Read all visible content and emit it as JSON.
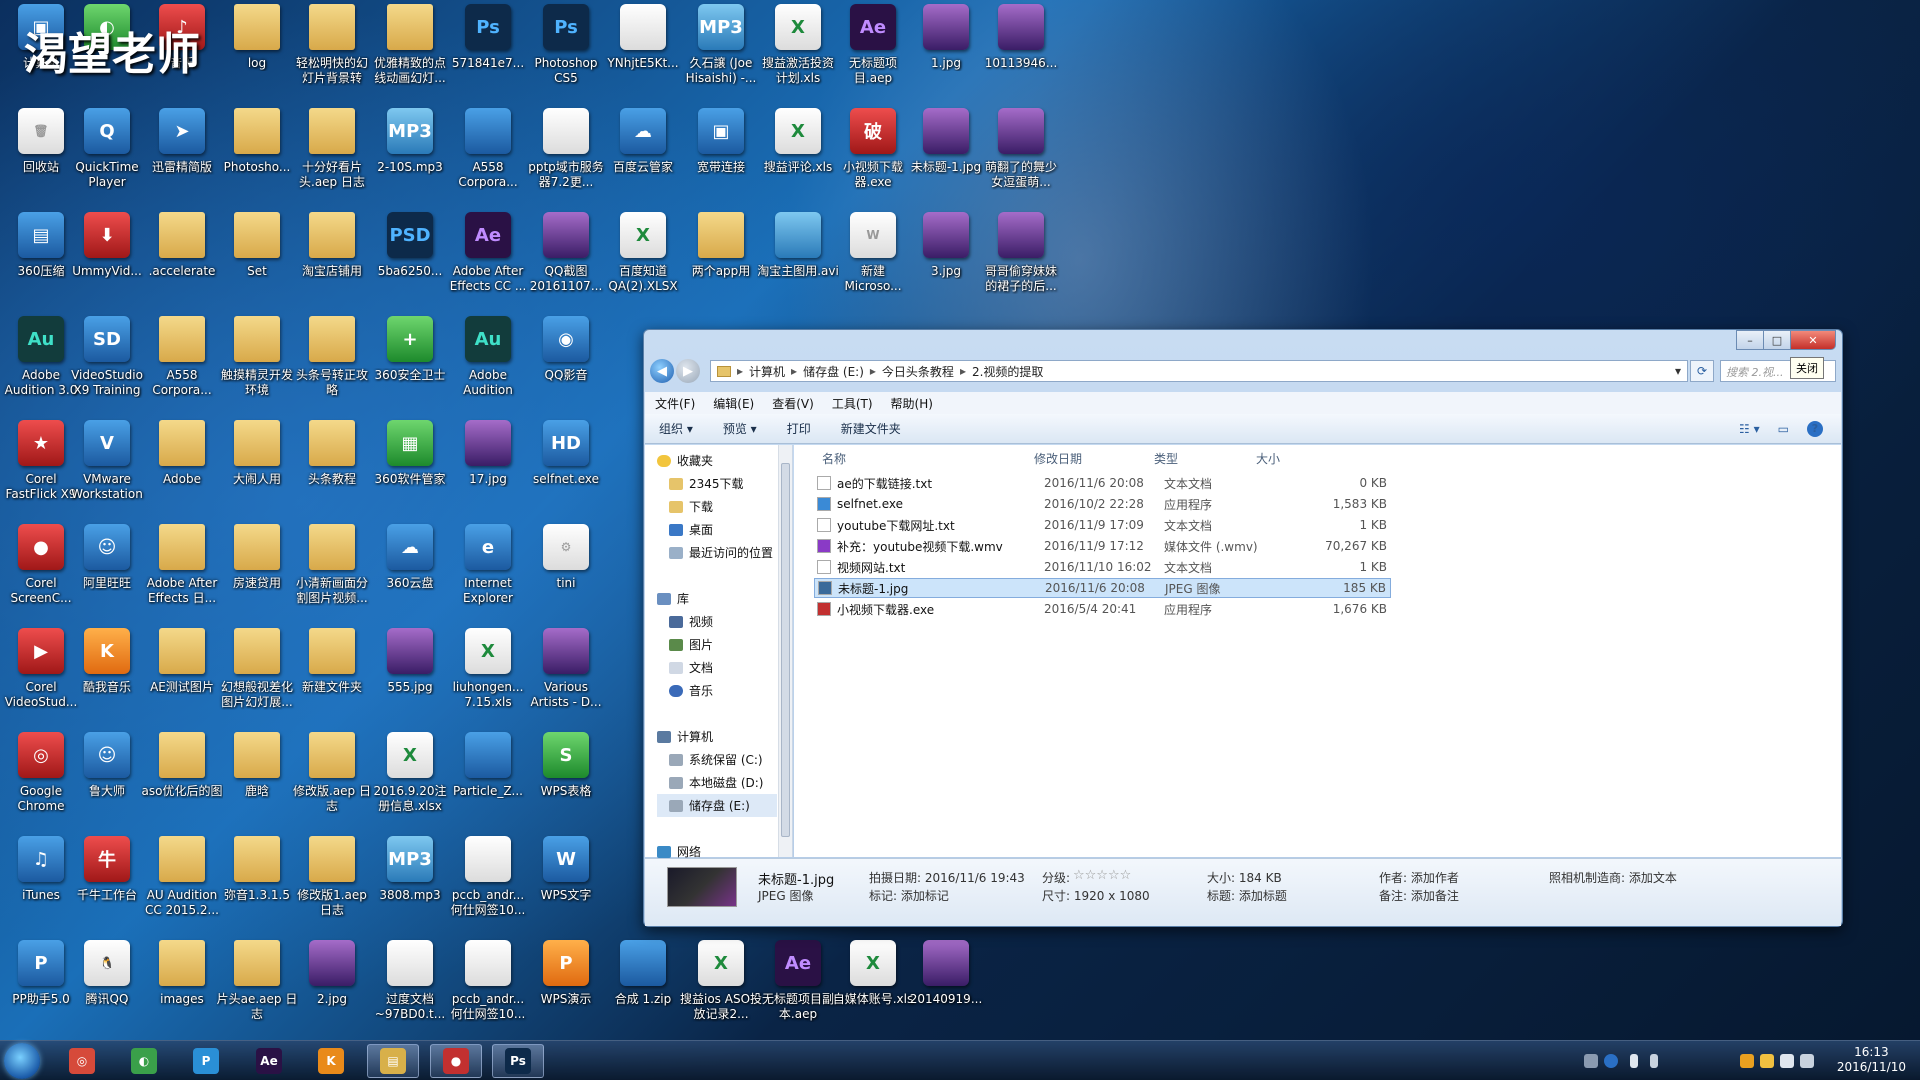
{
  "watermark": "渴望老师",
  "desktop_icons": [
    {
      "id": "r1c1",
      "label": "计算机",
      "kind": "exe",
      "glyph": "▣"
    },
    {
      "id": "r1c2",
      "label": "",
      "kind": "green",
      "glyph": "◐"
    },
    {
      "id": "r1c3",
      "label": "音乐",
      "kind": "red",
      "glyph": "♪"
    },
    {
      "id": "r1c4",
      "label": "log",
      "kind": "folder",
      "glyph": ""
    },
    {
      "id": "r1c5",
      "label": "轻松明快的幻灯片背景转场...",
      "kind": "folder",
      "glyph": ""
    },
    {
      "id": "r1c6",
      "label": "优雅精致的点线动画幻灯...",
      "kind": "folder",
      "glyph": ""
    },
    {
      "id": "r1c7",
      "label": "571841e7...",
      "kind": "ps",
      "glyph": "Ps"
    },
    {
      "id": "r1c8",
      "label": "Photoshop CS5",
      "kind": "ps",
      "glyph": "Ps"
    },
    {
      "id": "r1c9",
      "label": "YNhjtE5Kt...",
      "kind": "doc",
      "glyph": ""
    },
    {
      "id": "r1c10",
      "label": "久石譲 (Joe Hisaishi) -...",
      "kind": "media",
      "glyph": "MP3"
    },
    {
      "id": "r1c11",
      "label": "搜益激活投资计划.xls",
      "kind": "xls",
      "glyph": "X"
    },
    {
      "id": "r1c12",
      "label": "无标题项目.aep",
      "kind": "ae",
      "glyph": "Ae"
    },
    {
      "id": "r1c13",
      "label": "1.jpg",
      "kind": "img",
      "glyph": ""
    },
    {
      "id": "r1c14",
      "label": "10113946...",
      "kind": "img",
      "glyph": ""
    },
    {
      "id": "r2c1",
      "label": "回收站",
      "kind": "doc",
      "glyph": "🗑"
    },
    {
      "id": "r2c2",
      "label": "QuickTime Player",
      "kind": "exe",
      "glyph": "Q"
    },
    {
      "id": "r2c3",
      "label": "迅雷精简版",
      "kind": "exe",
      "glyph": "➤"
    },
    {
      "id": "r2c4",
      "label": "Photosho...",
      "kind": "folder",
      "glyph": ""
    },
    {
      "id": "r2c5",
      "label": "十分好看片头.aep 日志",
      "kind": "folder",
      "glyph": ""
    },
    {
      "id": "r2c6",
      "label": "2-10S.mp3",
      "kind": "media",
      "glyph": "MP3"
    },
    {
      "id": "r2c7",
      "label": "A558 Corpora...",
      "kind": "exe",
      "glyph": ""
    },
    {
      "id": "r2c8",
      "label": "pptp域市服务器7.2更...",
      "kind": "doc",
      "glyph": ""
    },
    {
      "id": "r2c9",
      "label": "百度云管家",
      "kind": "exe",
      "glyph": "☁"
    },
    {
      "id": "r2c10",
      "label": "宽带连接",
      "kind": "exe",
      "glyph": "▣"
    },
    {
      "id": "r2c11",
      "label": "搜益评论.xls",
      "kind": "xls",
      "glyph": "X"
    },
    {
      "id": "r2c12",
      "label": "小视频下载器.exe",
      "kind": "red",
      "glyph": "破"
    },
    {
      "id": "r2c13",
      "label": "未标题-1.jpg",
      "kind": "img",
      "glyph": ""
    },
    {
      "id": "r2c14",
      "label": "萌翻了的舞少女逗蛋萌...",
      "kind": "img",
      "glyph": ""
    },
    {
      "id": "r3c1",
      "label": "360压缩",
      "kind": "exe",
      "glyph": "▤"
    },
    {
      "id": "r3c2",
      "label": "UmmyVid...",
      "kind": "red",
      "glyph": "⬇"
    },
    {
      "id": "r3c3",
      "label": ".accelerate",
      "kind": "folder",
      "glyph": ""
    },
    {
      "id": "r3c4",
      "label": "Set",
      "kind": "folder",
      "glyph": ""
    },
    {
      "id": "r3c5",
      "label": "淘宝店铺用",
      "kind": "folder",
      "glyph": ""
    },
    {
      "id": "r3c6",
      "label": "5ba6250...",
      "kind": "ps",
      "glyph": "PSD"
    },
    {
      "id": "r3c7",
      "label": "Adobe After Effects CC ...",
      "kind": "ae",
      "glyph": "Ae"
    },
    {
      "id": "r3c8",
      "label": "QQ截图20161107...",
      "kind": "img",
      "glyph": ""
    },
    {
      "id": "r3c9",
      "label": "百度知道QA(2).XLSX",
      "kind": "xls",
      "glyph": "X"
    },
    {
      "id": "r3c10",
      "label": "两个app用",
      "kind": "folder",
      "glyph": ""
    },
    {
      "id": "r3c11",
      "label": "淘宝主图用.avi",
      "kind": "media",
      "glyph": ""
    },
    {
      "id": "r3c12",
      "label": "新建 Microso...",
      "kind": "doc",
      "glyph": "W"
    },
    {
      "id": "r3c13",
      "label": "3.jpg",
      "kind": "img",
      "glyph": ""
    },
    {
      "id": "r3c14",
      "label": "哥哥偷穿妹妹的裙子的后...",
      "kind": "img",
      "glyph": ""
    },
    {
      "id": "r4c1",
      "label": "Adobe Audition 3.0",
      "kind": "au",
      "glyph": "Au"
    },
    {
      "id": "r4c2",
      "label": "VideoStudio X9 Training",
      "kind": "exe",
      "glyph": "SD"
    },
    {
      "id": "r4c3",
      "label": "A558 Corpora...",
      "kind": "folder",
      "glyph": ""
    },
    {
      "id": "r4c4",
      "label": "触摸精灵开发环境",
      "kind": "folder",
      "glyph": ""
    },
    {
      "id": "r4c5",
      "label": "头条号转正攻略",
      "kind": "folder",
      "glyph": ""
    },
    {
      "id": "r4c6",
      "label": "360安全卫士",
      "kind": "green",
      "glyph": "+"
    },
    {
      "id": "r4c7",
      "label": "Adobe Audition",
      "kind": "au",
      "glyph": "Au"
    },
    {
      "id": "r4c8",
      "label": "QQ影音",
      "kind": "exe",
      "glyph": "◉"
    },
    {
      "id": "r5c1",
      "label": "Corel FastFlick X9",
      "kind": "red",
      "glyph": "★"
    },
    {
      "id": "r5c2",
      "label": "VMware Workstation",
      "kind": "exe",
      "glyph": "V"
    },
    {
      "id": "r5c3",
      "label": "Adobe",
      "kind": "folder",
      "glyph": ""
    },
    {
      "id": "r5c4",
      "label": "大闹人用",
      "kind": "folder",
      "glyph": ""
    },
    {
      "id": "r5c5",
      "label": "头条教程",
      "kind": "folder",
      "glyph": ""
    },
    {
      "id": "r5c6",
      "label": "360软件管家",
      "kind": "green",
      "glyph": "▦"
    },
    {
      "id": "r5c7",
      "label": "17.jpg",
      "kind": "img",
      "glyph": ""
    },
    {
      "id": "r5c8",
      "label": "selfnet.exe",
      "kind": "exe",
      "glyph": "HD"
    },
    {
      "id": "r6c1",
      "label": "Corel ScreenC...",
      "kind": "red",
      "glyph": "●"
    },
    {
      "id": "r6c2",
      "label": "阿里旺旺",
      "kind": "exe",
      "glyph": "☺"
    },
    {
      "id": "r6c3",
      "label": "Adobe After Effects 日...",
      "kind": "folder",
      "glyph": ""
    },
    {
      "id": "r6c4",
      "label": "房速贷用",
      "kind": "folder",
      "glyph": ""
    },
    {
      "id": "r6c5",
      "label": "小清新画面分割图片视频...",
      "kind": "folder",
      "glyph": ""
    },
    {
      "id": "r6c6",
      "label": "360云盘",
      "kind": "exe",
      "glyph": "☁"
    },
    {
      "id": "r6c7",
      "label": "Internet Explorer",
      "kind": "exe",
      "glyph": "e"
    },
    {
      "id": "r6c8",
      "label": "tini",
      "kind": "doc",
      "glyph": "⚙"
    },
    {
      "id": "r7c1",
      "label": "Corel VideoStud...",
      "kind": "red",
      "glyph": "▶"
    },
    {
      "id": "r7c2",
      "label": "酷我音乐",
      "kind": "orange",
      "glyph": "K"
    },
    {
      "id": "r7c3",
      "label": "AE测试图片",
      "kind": "folder",
      "glyph": ""
    },
    {
      "id": "r7c4",
      "label": "幻想般视差化图片幻灯展...",
      "kind": "folder",
      "glyph": ""
    },
    {
      "id": "r7c5",
      "label": "新建文件夹",
      "kind": "folder",
      "glyph": ""
    },
    {
      "id": "r7c6",
      "label": "555.jpg",
      "kind": "img",
      "glyph": ""
    },
    {
      "id": "r7c7",
      "label": "liuhongen... 7.15.xls",
      "kind": "xls",
      "glyph": "X"
    },
    {
      "id": "r7c8",
      "label": "Various Artists - D...",
      "kind": "img",
      "glyph": ""
    },
    {
      "id": "r8c1",
      "label": "Google Chrome",
      "kind": "red",
      "glyph": "◎"
    },
    {
      "id": "r8c2",
      "label": "鲁大师",
      "kind": "exe",
      "glyph": "☺"
    },
    {
      "id": "r8c3",
      "label": "aso优化后的图",
      "kind": "folder",
      "glyph": ""
    },
    {
      "id": "r8c4",
      "label": "鹿晗",
      "kind": "folder",
      "glyph": ""
    },
    {
      "id": "r8c5",
      "label": "修改版.aep 日志",
      "kind": "folder",
      "glyph": ""
    },
    {
      "id": "r8c6",
      "label": "2016.9.20注册信息.xlsx",
      "kind": "xls",
      "glyph": "X"
    },
    {
      "id": "r8c7",
      "label": "Particle_Z...",
      "kind": "exe",
      "glyph": ""
    },
    {
      "id": "r8c8",
      "label": "WPS表格",
      "kind": "green",
      "glyph": "S"
    },
    {
      "id": "r9c1",
      "label": "iTunes",
      "kind": "exe",
      "glyph": "♫"
    },
    {
      "id": "r9c2",
      "label": "千牛工作台",
      "kind": "red",
      "glyph": "牛"
    },
    {
      "id": "r9c3",
      "label": "AU Audition CC 2015.2...",
      "kind": "folder",
      "glyph": ""
    },
    {
      "id": "r9c4",
      "label": "弥音1.3.1.5",
      "kind": "folder",
      "glyph": ""
    },
    {
      "id": "r9c5",
      "label": "修改版1.aep 日志",
      "kind": "folder",
      "glyph": ""
    },
    {
      "id": "r9c6",
      "label": "3808.mp3",
      "kind": "media",
      "glyph": "MP3"
    },
    {
      "id": "r9c7",
      "label": "pccb_andr... 何仕网签10...",
      "kind": "doc",
      "glyph": ""
    },
    {
      "id": "r9c8",
      "label": "WPS文字",
      "kind": "exe",
      "glyph": "W"
    },
    {
      "id": "r10c1",
      "label": "PP助手5.0",
      "kind": "exe",
      "glyph": "P"
    },
    {
      "id": "r10c2",
      "label": "腾讯QQ",
      "kind": "doc",
      "glyph": "🐧"
    },
    {
      "id": "r10c3",
      "label": "images",
      "kind": "folder",
      "glyph": ""
    },
    {
      "id": "r10c4",
      "label": "片头ae.aep 日志",
      "kind": "folder",
      "glyph": ""
    },
    {
      "id": "r10c5",
      "label": "2.jpg",
      "kind": "img",
      "glyph": ""
    },
    {
      "id": "r10c6",
      "label": "过度文档~97BD0.t...",
      "kind": "doc",
      "glyph": ""
    },
    {
      "id": "r10c7",
      "label": "pccb_andr... 何仕网签10...",
      "kind": "doc",
      "glyph": ""
    },
    {
      "id": "r10c8",
      "label": "WPS演示",
      "kind": "orange",
      "glyph": "P"
    },
    {
      "id": "r10c9",
      "label": "合成 1.zip",
      "kind": "exe",
      "glyph": ""
    },
    {
      "id": "r10c10",
      "label": "搜益ios ASO投放记录2...",
      "kind": "xls",
      "glyph": "X"
    },
    {
      "id": "r10c11",
      "label": "无标题项目副本.aep",
      "kind": "ae",
      "glyph": "Ae"
    },
    {
      "id": "r10c12",
      "label": "自媒体账号.xls",
      "kind": "xls",
      "glyph": "X"
    },
    {
      "id": "r10c13",
      "label": "20140919...",
      "kind": "img",
      "glyph": ""
    }
  ],
  "window": {
    "tooltip": "关闭",
    "controls": {
      "minimize": "–",
      "maximize": "□",
      "close": "✕"
    },
    "address": [
      "计算机",
      "储存盘 (E:)",
      "今日头条教程",
      "2.视频的提取"
    ],
    "search_placeholder": "搜索 2.视...",
    "menu": [
      "文件(F)",
      "编辑(E)",
      "查看(V)",
      "工具(T)",
      "帮助(H)"
    ],
    "toolbar": {
      "organize": "组织 ▾",
      "preview": "预览 ▾",
      "print": "打印",
      "new_folder": "新建文件夹"
    },
    "nav": {
      "favorites_label": "收藏夹",
      "favorites": [
        "2345下载",
        "下载",
        "桌面",
        "最近访问的位置"
      ],
      "libraries_label": "库",
      "libraries": [
        "视频",
        "图片",
        "文档",
        "音乐"
      ],
      "computer_label": "计算机",
      "drives": [
        "系统保留 (C:)",
        "本地磁盘 (D:)",
        "储存盘 (E:)"
      ],
      "network_label": "网络"
    },
    "columns": {
      "name": "名称",
      "date": "修改日期",
      "type": "类型",
      "size": "大小"
    },
    "files": [
      {
        "name": "ae的下载链接.txt",
        "date": "2016/11/6 20:08",
        "type": "文本文档",
        "size": "0 KB",
        "icon": "txt"
      },
      {
        "name": "selfnet.exe",
        "date": "2016/10/2 22:28",
        "type": "应用程序",
        "size": "1,583 KB",
        "icon": "exe"
      },
      {
        "name": "youtube下载网址.txt",
        "date": "2016/11/9 17:09",
        "type": "文本文档",
        "size": "1 KB",
        "icon": "txt"
      },
      {
        "name": "补充：youtube视频下载.wmv",
        "date": "2016/11/9 17:12",
        "type": "媒体文件 (.wmv)",
        "size": "70,267 KB",
        "icon": "wmv"
      },
      {
        "name": "视频网站.txt",
        "date": "2016/11/10 16:02",
        "type": "文本文档",
        "size": "1 KB",
        "icon": "txt"
      },
      {
        "name": "未标题-1.jpg",
        "date": "2016/11/6 20:08",
        "type": "JPEG 图像",
        "size": "185 KB",
        "icon": "jpg"
      },
      {
        "name": "小视频下载器.exe",
        "date": "2016/5/4 20:41",
        "type": "应用程序",
        "size": "1,676 KB",
        "icon": "exe2"
      }
    ],
    "details": {
      "filename": "未标题-1.jpg",
      "filetype": "JPEG 图像",
      "shot_date": "拍摄日期: 2016/11/6 19:43",
      "tags": "标记: 添加标记",
      "rating": "分级:",
      "stars": "☆☆☆☆☆",
      "dimensions": "尺寸: 1920 x 1080",
      "size": "大小: 184 KB",
      "title": "标题: 添加标题",
      "author": "作者: 添加作者",
      "comments": "备注: 添加备注",
      "camera": "照相机制造商: 添加文本"
    }
  },
  "taskbar": {
    "apps": [
      {
        "name": "chrome",
        "glyph": "◎",
        "color": "#d64a3a"
      },
      {
        "name": "360",
        "glyph": "◐",
        "color": "#3aa04a"
      },
      {
        "name": "pp",
        "glyph": "P",
        "color": "#2a8fd6"
      },
      {
        "name": "ae",
        "glyph": "Ae",
        "color": "#2a1145"
      },
      {
        "name": "kuwo",
        "glyph": "K",
        "color": "#e98a1a"
      },
      {
        "name": "explorer",
        "glyph": "▤",
        "color": "#d8b04a"
      },
      {
        "name": "recorder",
        "glyph": "●",
        "color": "#c23030"
      },
      {
        "name": "ps",
        "glyph": "Ps",
        "color": "#0d2a4a"
      }
    ],
    "time": "16:13",
    "date": "2016/11/10"
  }
}
